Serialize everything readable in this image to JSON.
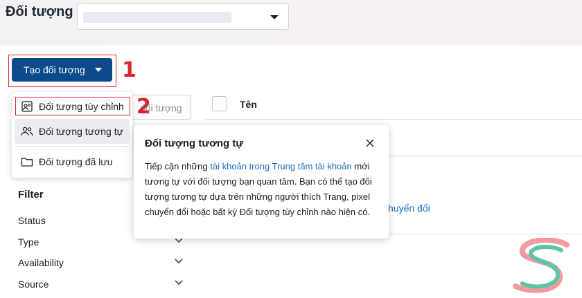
{
  "header": {
    "title": "Đối tượng",
    "select_value": ""
  },
  "toolbar": {
    "create_label": "Tạo đối tượng",
    "step_1": "1",
    "step_2": "2"
  },
  "search": {
    "placeholder": "đối tượng"
  },
  "table": {
    "name_header": "Tên",
    "link_text": "huyển đổi"
  },
  "create_menu": {
    "items": [
      {
        "label": "Đối tượng tùy chỉnh",
        "icon": "custom-audience-icon"
      },
      {
        "label": "Đối tượng tương tự",
        "icon": "lookalike-audience-icon"
      },
      {
        "label": "Đối tượng đã lưu",
        "icon": "folder-icon"
      }
    ]
  },
  "filter": {
    "title": "Filter",
    "rows": [
      "Status",
      "Type",
      "Availability",
      "Source"
    ]
  },
  "tooltip": {
    "title": "Đối tượng tương tự",
    "text_1": "Tiếp cận những ",
    "link": "tài khoản trong Trung tâm tài khoản",
    "text_2": " mới tương tự với đối tượng bạn quan tâm. Bạn có thể tạo đối tượng tương tự dựa trên những người thích Trang, pixel chuyển đổi hoặc bất kỳ Đối tượng tùy chỉnh nào hiện có."
  },
  "colors": {
    "primary_button": "#0b4a8b",
    "link": "#1a6ec2",
    "annotation_red": "#d9262e"
  }
}
